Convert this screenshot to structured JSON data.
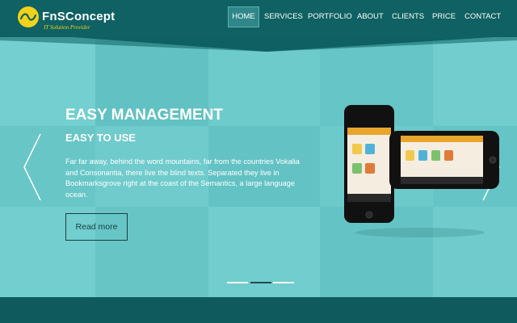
{
  "logo": {
    "name": "FnSConcept",
    "tagline": "IT Solution Provider"
  },
  "nav": {
    "items": [
      "HOME",
      "SERVICES",
      "PORTFOLIO",
      "ABOUT",
      "CLIENTS",
      "PRICE",
      "CONTACT"
    ],
    "active": "HOME"
  },
  "hero": {
    "title": "EASY MANAGEMENT",
    "subtitle": "EASY TO USE",
    "text": "Far far away, behind the word mountains, far from the countries Vokalia and Consonantia, there live the blind texts. Separated they live in Bookmarksgrove right at the coast of the Semantics, a large language ocean.",
    "button_label": "Read more"
  },
  "slider": {
    "slide_count": 3,
    "active_slide": 2
  },
  "colors": {
    "header": "#0f6163",
    "hero_bg": "#6ac8c9",
    "accent_yellow": "#f2d21b",
    "dark_text": "#1b3e40"
  },
  "icons": [
    "logo-swoosh-icon",
    "chevron-left-icon",
    "chevron-right-icon",
    "phone-image"
  ]
}
